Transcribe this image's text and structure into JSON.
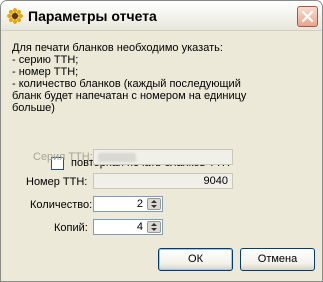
{
  "window": {
    "title": "Параметры отчета",
    "icon": "sunflower-icon"
  },
  "description": {
    "lines": [
      "Для печати бланков необходимо указать:",
      " - серию ТТН;",
      " - номер ТТН;",
      " - количество бланков (каждый последующий",
      "бланк будет напечатан  с номером на единицу",
      "больше)"
    ]
  },
  "reprint": {
    "label": "повторная печать бланков ТТН",
    "checked": false
  },
  "series": {
    "label": "Серия ТТН:"
  },
  "number": {
    "label": "Номер ТТН:",
    "value": "9040"
  },
  "quantity": {
    "label": "Количество:",
    "value": "2"
  },
  "copies": {
    "label": "Копий:",
    "value": "4"
  },
  "buttons": {
    "ok": "ОК",
    "cancel": "Отмена"
  }
}
